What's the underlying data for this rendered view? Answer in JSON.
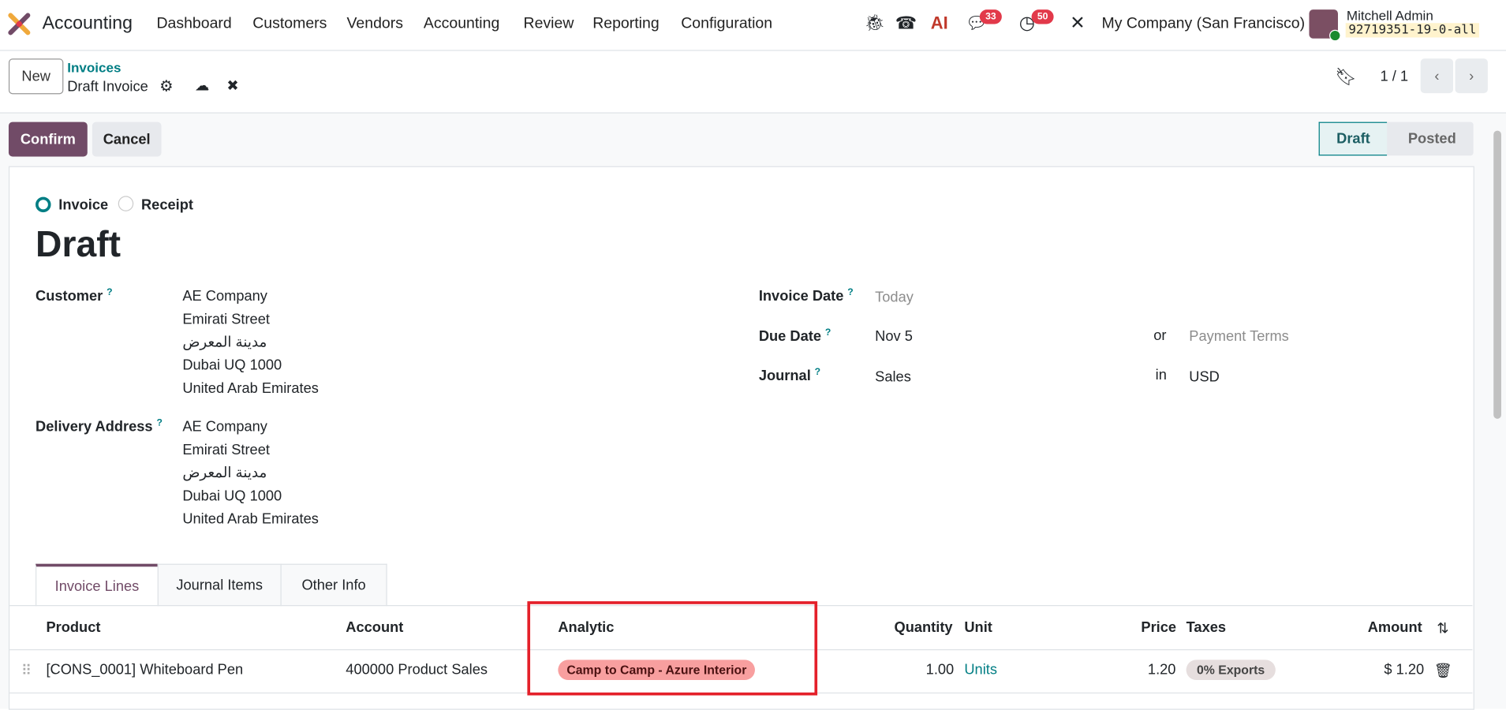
{
  "nav": {
    "app": "Accounting",
    "menu": [
      "Dashboard",
      "Customers",
      "Vendors",
      "Accounting",
      "Review",
      "Reporting",
      "Configuration"
    ],
    "messages_count": "33",
    "activities_count": "50",
    "ai_label": "AI",
    "company": "My Company (San Francisco)",
    "user": "Mitchell Admin",
    "db": "92719351-19-0-all"
  },
  "control": {
    "new": "New",
    "breadcrumb_parent": "Invoices",
    "breadcrumb_current": "Draft Invoice",
    "pager": "1 / 1"
  },
  "actions": {
    "confirm": "Confirm",
    "cancel": "Cancel",
    "status": [
      "Draft",
      "Posted"
    ]
  },
  "form": {
    "type_options": [
      "Invoice",
      "Receipt"
    ],
    "title": "Draft",
    "customer_label": "Customer",
    "customer_lines": [
      "AE Company",
      "Emirati Street",
      "مدينة المعرض",
      "Dubai UQ 1000",
      "United Arab Emirates"
    ],
    "delivery_label": "Delivery Address",
    "delivery_lines": [
      "AE Company",
      "Emirati Street",
      "مدينة المعرض",
      "Dubai UQ 1000",
      "United Arab Emirates"
    ],
    "invoice_date_label": "Invoice Date",
    "invoice_date_placeholder": "Today",
    "due_date_label": "Due Date",
    "due_date": "Nov 5",
    "or": "or",
    "payment_terms_placeholder": "Payment Terms",
    "journal_label": "Journal",
    "journal": "Sales",
    "in": "in",
    "currency": "USD",
    "help": "?"
  },
  "tabs": [
    "Invoice Lines",
    "Journal Items",
    "Other Info"
  ],
  "table": {
    "headers": [
      "Product",
      "Account",
      "Analytic",
      "Quantity",
      "Unit",
      "Price",
      "Taxes",
      "Amount"
    ],
    "rows": [
      {
        "product": "[CONS_0001] Whiteboard Pen",
        "account": "400000 Product Sales",
        "analytic": "Camp to Camp - Azure Interior",
        "quantity": "1.00",
        "unit": "Units",
        "price": "1.20",
        "taxes": "0% Exports",
        "amount": "$ 1.20"
      }
    ]
  },
  "colors": {
    "primary": "#714b67",
    "teal": "#017e84",
    "highlight": "#e4202a"
  }
}
